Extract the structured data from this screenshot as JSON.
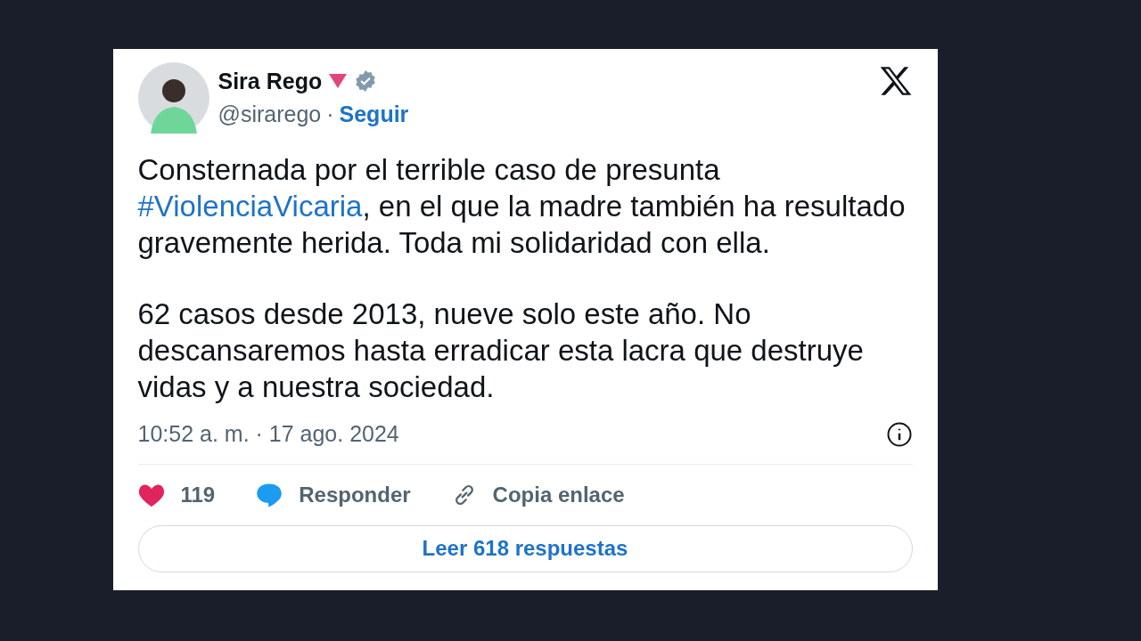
{
  "tweet": {
    "author": {
      "name": "Sira Rego",
      "handle": "@sirarego",
      "separator": "·",
      "follow": "Seguir",
      "verified": true
    },
    "paragraphs": [
      {
        "parts": [
          {
            "kind": "text",
            "text": "Consternada por el terrible caso de presunta "
          },
          {
            "kind": "hashtag",
            "text": "#ViolenciaVicaria"
          },
          {
            "kind": "text",
            "text": ", en el que la madre también ha resultado gravemente herida. Toda mi solidaridad con ella."
          }
        ]
      },
      {
        "parts": [
          {
            "kind": "text",
            "text": "62 casos desde 2013, nueve solo este año. No descansaremos hasta erradicar esta lacra que destruye vidas y a nuestra sociedad."
          }
        ]
      }
    ],
    "timestamp": "10:52 a. m. · 17 ago. 2024",
    "actions": [
      {
        "kind": "like",
        "label": "119"
      },
      {
        "kind": "reply",
        "label": "Responder"
      },
      {
        "kind": "link",
        "label": "Copia enlace"
      }
    ],
    "read_replies": "Leer 618 respuestas"
  }
}
